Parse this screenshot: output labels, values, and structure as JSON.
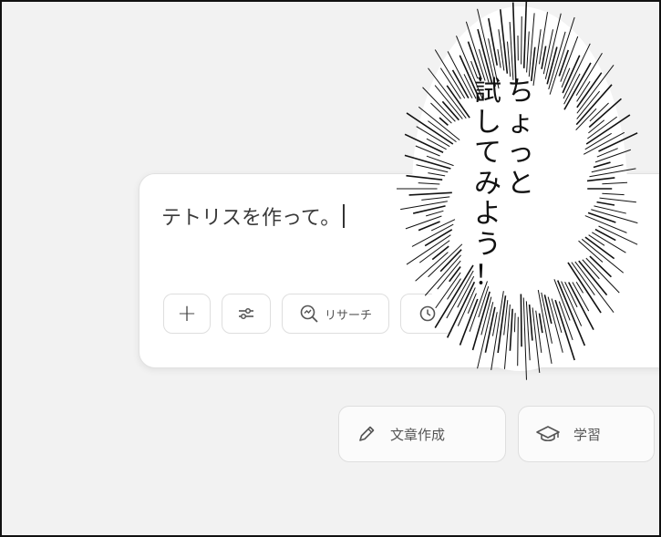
{
  "chat": {
    "prompt": "テトリスを作って。",
    "tools": {
      "plus": "+",
      "research": "リサーチ"
    }
  },
  "suggestions": [
    {
      "label": "文章作成",
      "icon": "pencil-icon"
    },
    {
      "label": "学習",
      "icon": "graduation-cap-icon"
    }
  ],
  "speech_bubble": {
    "line1": "ちょっと",
    "line2": "試してみよう！"
  }
}
